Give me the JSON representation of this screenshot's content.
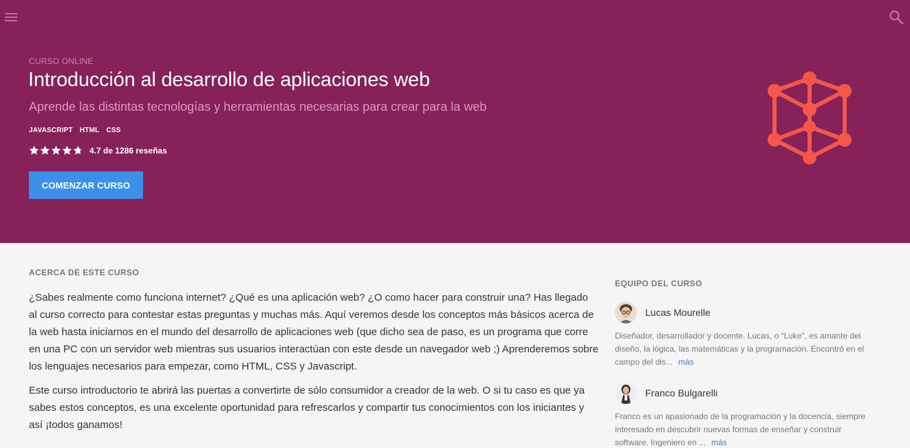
{
  "header": {
    "menu_icon": "hamburger-menu-icon",
    "search_icon": "search-icon"
  },
  "hero": {
    "eyebrow": "CURSO ONLINE",
    "title": "Introducción al desarrollo de aplicaciones web",
    "subtitle": "Aprende las distintas tecnologías y herramientas necesarias para crear para la web",
    "tags": [
      "JAVASCRIPT",
      "HTML",
      "CSS"
    ],
    "rating": {
      "value": 4.7,
      "stars_max": 5,
      "text": "4.7 de 1286 reseñas"
    },
    "cta_label": "COMENZAR CURSO",
    "illustration": "cube-network-icon"
  },
  "about": {
    "heading": "ACERCA DE ESTE CURSO",
    "paragraphs": [
      "¿Sabes realmente como funciona internet? ¿Qué es una aplicación web? ¿O como hacer para construir una? Has llegado al curso correcto para contestar estas preguntas y muchas más. Aquí veremos desde los conceptos más básicos acerca de la web hasta iniciarnos en el mundo del desarrollo de aplicaciones web (que dicho sea de paso, es un programa que corre en una PC con un servidor web mientras sus usuarios interactúan con este desde un navegador web ;) Aprenderemos sobre los lenguajes necesarios para empezar, como HTML, CSS y Javascript.",
      "Este curso introductorio te abrirá las puertas a convertirte de sólo consumidor a creador de la web. O si tu caso es que ya sabes estos conceptos, es una excelente oportunidad para refrescarlos y compartir tus conocimientos con los iniciantes y así ¡todos ganamos!"
    ]
  },
  "team": {
    "heading": "EQUIPO DEL CURSO",
    "members": [
      {
        "name": "Lucas Mourelle",
        "bio": "Diseñador, desarrollador y docente. Lucas, o “Luke”, es amante del diseño, la lógica, las matemáticas y la programación. Encontró en el campo del dis...",
        "more": "más"
      },
      {
        "name": "Franco Bulgarelli",
        "bio": "Franco es un apasionado de la programación y la docencia, siempre interesado en descubrir nuevas formas de enseñar y construir software. Ingeniero en ...",
        "more": "más"
      }
    ]
  },
  "colors": {
    "hero_bg": "#86215a",
    "accent_button": "#3b90ea",
    "illustration": "#f4574a",
    "link": "#3b7dd8"
  }
}
